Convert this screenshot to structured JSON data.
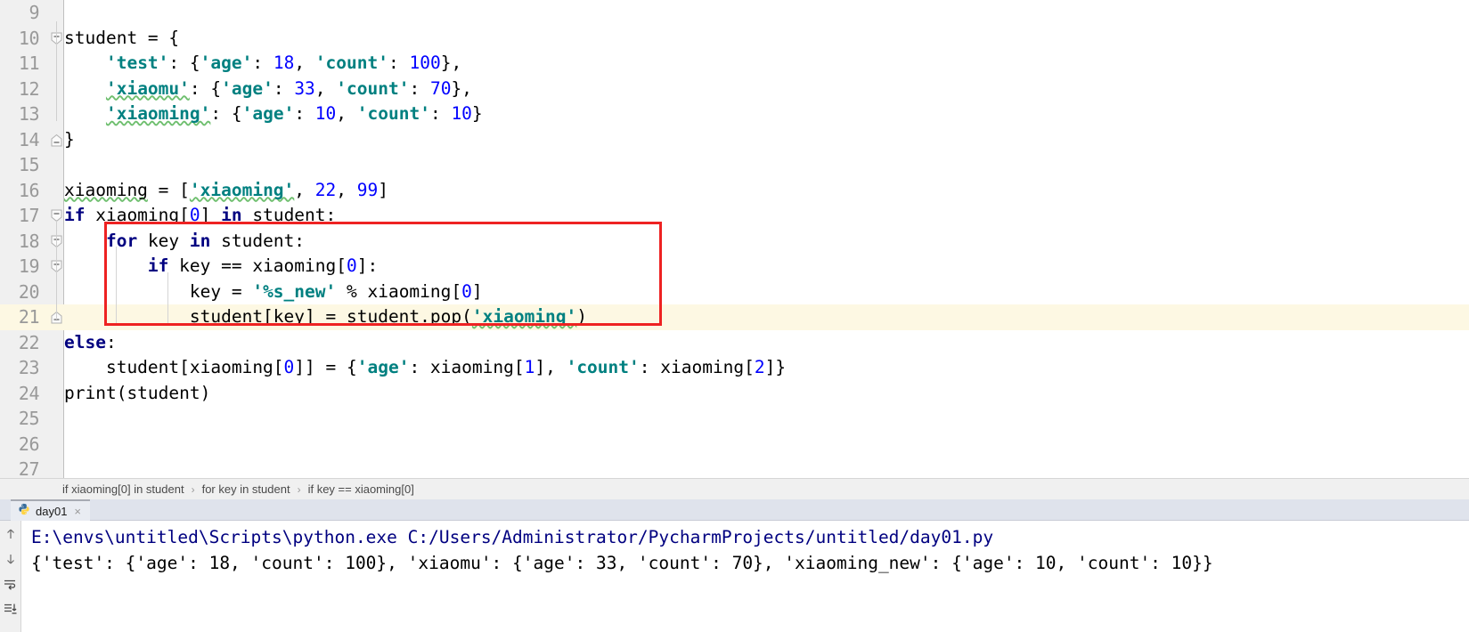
{
  "editor": {
    "language": "python",
    "current_line": 21,
    "first_visible_line": 9,
    "lines": [
      {
        "number": "9",
        "text": "",
        "tokens": []
      },
      {
        "number": "10",
        "text": "student = {",
        "tokens": [
          {
            "t": "student = {",
            "c": "plain"
          }
        ],
        "fold": "start"
      },
      {
        "number": "11",
        "text": "    'test': {'age': 18, 'count': 100},",
        "tokens": [
          {
            "t": "    ",
            "c": "plain"
          },
          {
            "t": "'test'",
            "c": "str"
          },
          {
            "t": ": {",
            "c": "plain"
          },
          {
            "t": "'age'",
            "c": "str"
          },
          {
            "t": ": ",
            "c": "plain"
          },
          {
            "t": "18",
            "c": "num"
          },
          {
            "t": ", ",
            "c": "plain"
          },
          {
            "t": "'count'",
            "c": "str"
          },
          {
            "t": ": ",
            "c": "plain"
          },
          {
            "t": "100",
            "c": "num"
          },
          {
            "t": "},",
            "c": "plain"
          }
        ]
      },
      {
        "number": "12",
        "text": "    'xiaomu': {'age': 33, 'count': 70},",
        "tokens": [
          {
            "t": "    ",
            "c": "plain"
          },
          {
            "t": "'xiaomu'",
            "c": "str typo"
          },
          {
            "t": ": {",
            "c": "plain"
          },
          {
            "t": "'age'",
            "c": "str"
          },
          {
            "t": ": ",
            "c": "plain"
          },
          {
            "t": "33",
            "c": "num"
          },
          {
            "t": ", ",
            "c": "plain"
          },
          {
            "t": "'count'",
            "c": "str"
          },
          {
            "t": ": ",
            "c": "plain"
          },
          {
            "t": "70",
            "c": "num"
          },
          {
            "t": "},",
            "c": "plain"
          }
        ]
      },
      {
        "number": "13",
        "text": "    'xiaoming': {'age': 10, 'count': 10}",
        "tokens": [
          {
            "t": "    ",
            "c": "plain"
          },
          {
            "t": "'xiaoming'",
            "c": "str typo"
          },
          {
            "t": ": {",
            "c": "plain"
          },
          {
            "t": "'age'",
            "c": "str"
          },
          {
            "t": ": ",
            "c": "plain"
          },
          {
            "t": "10",
            "c": "num"
          },
          {
            "t": ", ",
            "c": "plain"
          },
          {
            "t": "'count'",
            "c": "str"
          },
          {
            "t": ": ",
            "c": "plain"
          },
          {
            "t": "10",
            "c": "num"
          },
          {
            "t": "}",
            "c": "plain"
          }
        ]
      },
      {
        "number": "14",
        "text": "}",
        "tokens": [
          {
            "t": "}",
            "c": "plain"
          }
        ],
        "fold": "end"
      },
      {
        "number": "15",
        "text": "",
        "tokens": []
      },
      {
        "number": "16",
        "text": "xiaoming = ['xiaoming', 22, 99]",
        "tokens": [
          {
            "t": "xiaoming",
            "c": "plain typo"
          },
          {
            "t": " = [",
            "c": "plain"
          },
          {
            "t": "'xiaoming'",
            "c": "str typo"
          },
          {
            "t": ", ",
            "c": "plain"
          },
          {
            "t": "22",
            "c": "num"
          },
          {
            "t": ", ",
            "c": "plain"
          },
          {
            "t": "99",
            "c": "num"
          },
          {
            "t": "]",
            "c": "plain"
          }
        ]
      },
      {
        "number": "17",
        "text": "if xiaoming[0] in student:",
        "tokens": [
          {
            "t": "if",
            "c": "kw"
          },
          {
            "t": " xiaoming[",
            "c": "plain"
          },
          {
            "t": "0",
            "c": "num"
          },
          {
            "t": "] ",
            "c": "plain"
          },
          {
            "t": "in",
            "c": "kw"
          },
          {
            "t": " student:",
            "c": "plain"
          }
        ],
        "fold": "start"
      },
      {
        "number": "18",
        "text": "    for key in student:",
        "tokens": [
          {
            "t": "    ",
            "c": "plain"
          },
          {
            "t": "for",
            "c": "kw"
          },
          {
            "t": " key ",
            "c": "plain"
          },
          {
            "t": "in",
            "c": "kw"
          },
          {
            "t": " student:",
            "c": "plain"
          }
        ],
        "fold": "start"
      },
      {
        "number": "19",
        "text": "        if key == xiaoming[0]:",
        "tokens": [
          {
            "t": "        ",
            "c": "plain"
          },
          {
            "t": "if",
            "c": "kw"
          },
          {
            "t": " key == xiaoming[",
            "c": "plain"
          },
          {
            "t": "0",
            "c": "num"
          },
          {
            "t": "]:",
            "c": "plain"
          }
        ],
        "fold": "start"
      },
      {
        "number": "20",
        "text": "            key = '%s_new' % xiaoming[0]",
        "tokens": [
          {
            "t": "            key = ",
            "c": "plain"
          },
          {
            "t": "'%s_new'",
            "c": "str"
          },
          {
            "t": " % xiaoming[",
            "c": "plain"
          },
          {
            "t": "0",
            "c": "num"
          },
          {
            "t": "]",
            "c": "plain"
          }
        ]
      },
      {
        "number": "21",
        "text": "            student[key] = student.pop('xiaoming')",
        "tokens": [
          {
            "t": "            student[key] = student.pop(",
            "c": "plain"
          },
          {
            "t": "'xiaoming'",
            "c": "str typo"
          },
          {
            "t": ")",
            "c": "plain"
          }
        ],
        "fold": "end"
      },
      {
        "number": "22",
        "text": "else:",
        "tokens": [
          {
            "t": "else",
            "c": "kw"
          },
          {
            "t": ":",
            "c": "plain"
          }
        ]
      },
      {
        "number": "23",
        "text": "    student[xiaoming[0]] = {'age': xiaoming[1], 'count': xiaoming[2]}",
        "tokens": [
          {
            "t": "    student[xiaoming[",
            "c": "plain"
          },
          {
            "t": "0",
            "c": "num"
          },
          {
            "t": "]] = {",
            "c": "plain"
          },
          {
            "t": "'age'",
            "c": "str"
          },
          {
            "t": ": xiaoming[",
            "c": "plain"
          },
          {
            "t": "1",
            "c": "num"
          },
          {
            "t": "], ",
            "c": "plain"
          },
          {
            "t": "'count'",
            "c": "str"
          },
          {
            "t": ": xiaoming[",
            "c": "plain"
          },
          {
            "t": "2",
            "c": "num"
          },
          {
            "t": "]}",
            "c": "plain"
          }
        ]
      },
      {
        "number": "24",
        "text": "print(student)",
        "tokens": [
          {
            "t": "print",
            "c": "fn"
          },
          {
            "t": "(student)",
            "c": "plain"
          }
        ]
      },
      {
        "number": "25",
        "text": "",
        "tokens": []
      },
      {
        "number": "26",
        "text": "",
        "tokens": []
      },
      {
        "number": "27",
        "text": "",
        "tokens": []
      }
    ],
    "annotation": {
      "shape": "rectangle",
      "color": "#ee2222",
      "covers_lines": "18-21"
    },
    "colors": {
      "keyword": "#000080",
      "string": "#008080",
      "number": "#0000ff",
      "text": "#000000",
      "gutter_bg": "#f0f0f0",
      "current_line_bg": "#fdf8e3",
      "annotation": "#ee2222"
    }
  },
  "breadcrumb": {
    "items": [
      "if xiaoming[0] in student",
      "for key in student",
      "if key == xiaoming[0]"
    ],
    "separator": "›"
  },
  "run_window": {
    "tab": {
      "label": "day01",
      "icon": "python-file-icon",
      "close": "×"
    },
    "toolbar": [
      {
        "name": "up-arrow-icon",
        "glyph": "↑"
      },
      {
        "name": "down-arrow-icon",
        "glyph": "↓"
      },
      {
        "name": "soft-wrap-icon",
        "glyph": "⇥"
      },
      {
        "name": "scroll-to-end-icon",
        "glyph": "⇟"
      }
    ],
    "console": {
      "command": "E:\\envs\\untitled\\Scripts\\python.exe C:/Users/Administrator/PycharmProjects/untitled/day01.py",
      "output": "{'test': {'age': 18, 'count': 100}, 'xiaomu': {'age': 33, 'count': 70}, 'xiaoming_new': {'age': 10, 'count': 10}}"
    }
  }
}
